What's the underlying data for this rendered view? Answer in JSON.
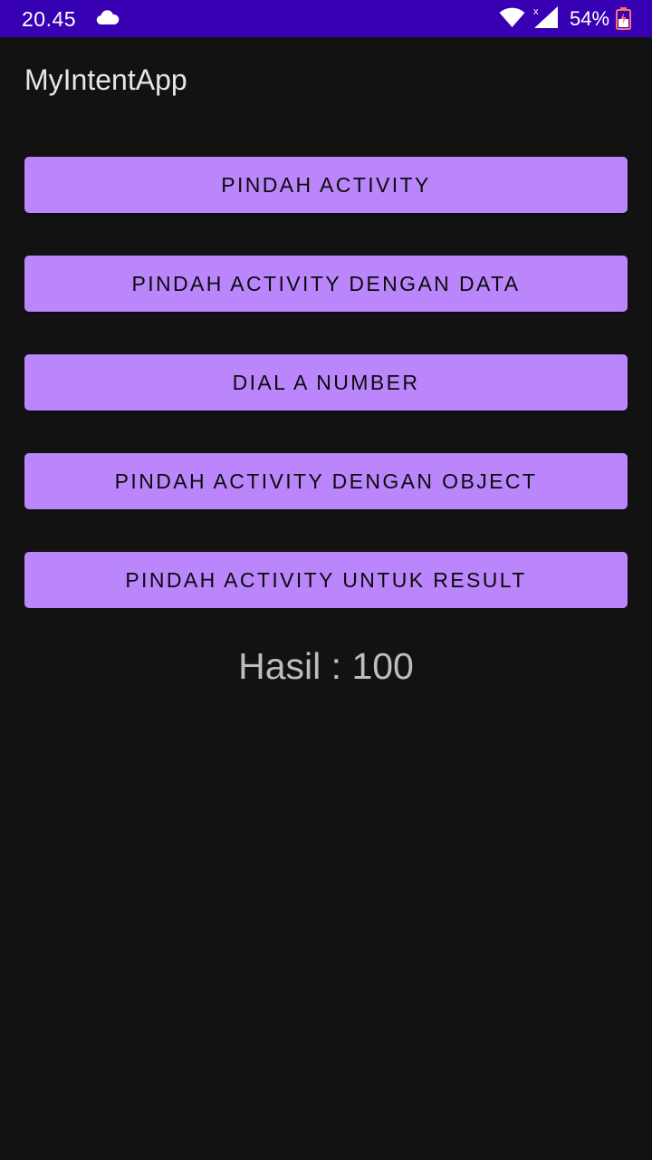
{
  "status_bar": {
    "time": "20.45",
    "battery": "54%",
    "icons": [
      "cloud-icon",
      "wifi-icon",
      "signal-icon",
      "battery-icon"
    ],
    "background": "#3700b3"
  },
  "app": {
    "title": "MyIntentApp"
  },
  "buttons": [
    {
      "label": "PINDAH ACTIVITY"
    },
    {
      "label": "PINDAH ACTIVITY DENGAN DATA"
    },
    {
      "label": "DIAL A NUMBER"
    },
    {
      "label": "PINDAH ACTIVITY DENGAN OBJECT"
    },
    {
      "label": "PINDAH ACTIVITY UNTUK RESULT"
    }
  ],
  "result": {
    "text": "Hasil : 100"
  },
  "colors": {
    "accent": "#bb86fc",
    "background": "#121212"
  }
}
